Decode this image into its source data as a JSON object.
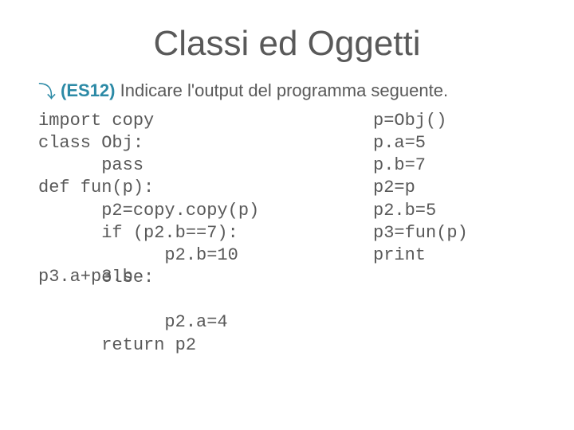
{
  "title": "Classi ed Oggetti",
  "bullet": {
    "tag": "(ES12)",
    "text": " Indicare l'output del programma seguente."
  },
  "code_left": "import copy\nclass Obj:\n      pass\ndef fun(p):\n      p2=copy.copy(p)\n      if (p2.b==7):\n            p2.b=10\n      else:\n\n            p2.a=4\n      return p2",
  "overlap_line": "p3.a+p3.b",
  "code_right": "p=Obj()\np.a=5\np.b=7\np2=p\np2.b=5\np3=fun(p)\nprint"
}
